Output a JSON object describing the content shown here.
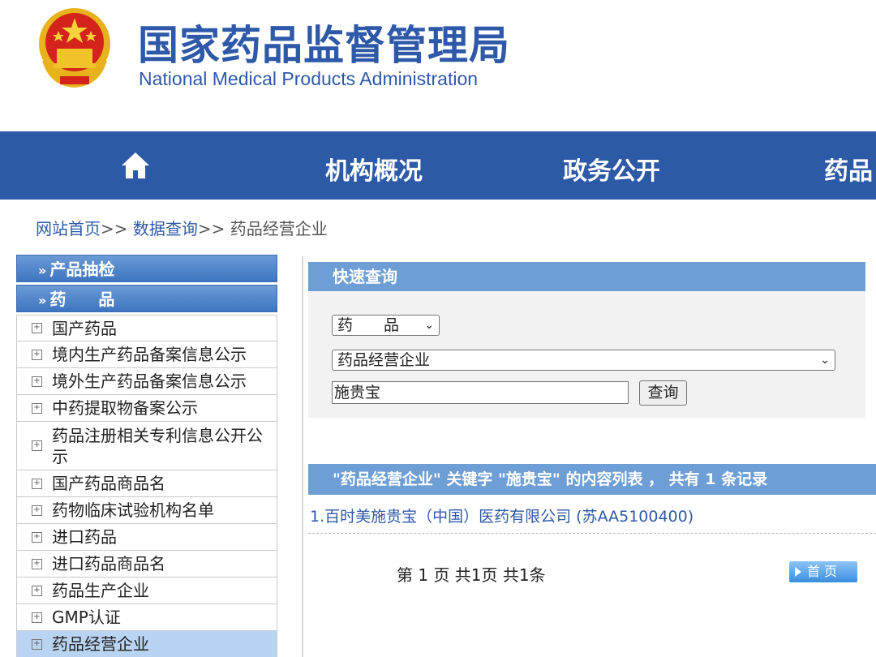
{
  "header": {
    "title_cn": "国家药品监督管理局",
    "title_en": "National Medical Products Administration"
  },
  "nav": {
    "home_icon": "home-icon",
    "items": [
      "机构概况",
      "政务公开",
      "药品"
    ]
  },
  "breadcrumb": {
    "home": "网站首页",
    "sep1": ">>",
    "data": "数据查询",
    "sep2": ">>",
    "current": "药品经营企业"
  },
  "sidebar": {
    "headers": [
      "产品抽检",
      "药　　品"
    ],
    "items": [
      "国产药品",
      "境内生产药品备案信息公示",
      "境外生产药品备案信息公示",
      "中药提取物备案公示",
      "药品注册相关专利信息公开公示",
      "国产药品商品名",
      "药物临床试验机构名单",
      "进口药品",
      "进口药品商品名",
      "药品生产企业",
      "GMP认证",
      "药品经营企业"
    ],
    "active_index": 11
  },
  "quick_search": {
    "title": "快速查询",
    "category_value": "药　　品",
    "database_value": "药品经营企业",
    "keyword_value": "施贵宝",
    "search_label": "查询"
  },
  "results": {
    "header": "\"药品经营企业\" 关键字 \"施贵宝\" 的内容列表 ， 共有 1 条记录",
    "rows": [
      "1.百时美施贵宝（中国）医药有限公司 (苏AA5100400)"
    ],
    "pager": "第 1 页 共1页 共1条",
    "first_page_label": "首 页"
  },
  "colors": {
    "brand_blue": "#2d5aa6",
    "panel_blue": "#6d9ed6",
    "active_item": "#b9d4f2"
  }
}
